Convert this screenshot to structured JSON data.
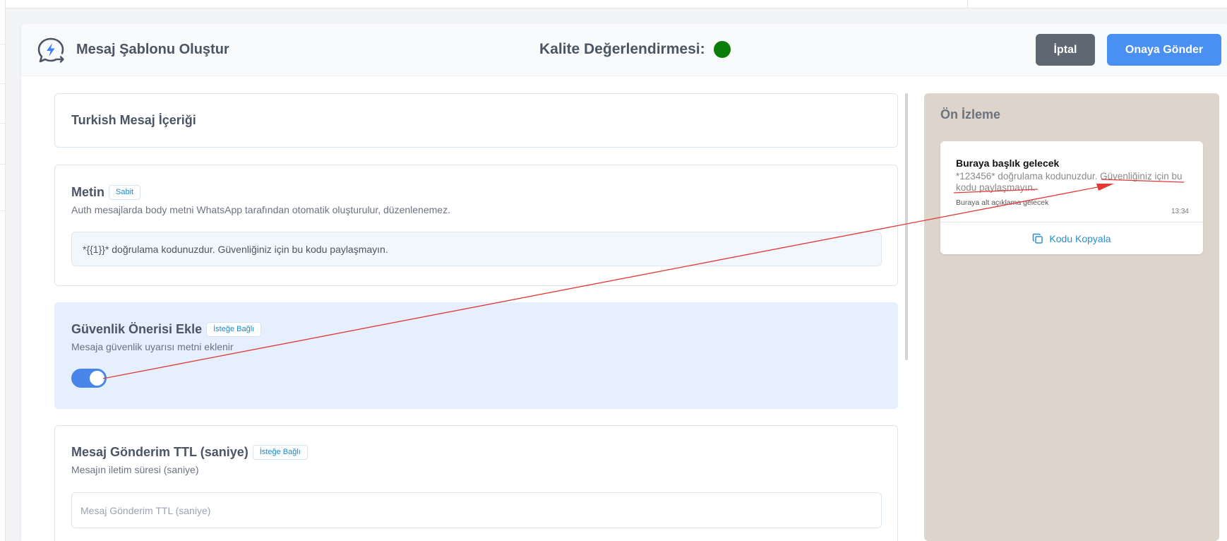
{
  "header": {
    "title": "Mesaj Şablonu Oluştur",
    "quality_label": "Kalite Değerlendirmesi:",
    "quality_color": "#0a7d0a",
    "cancel_label": "İptal",
    "submit_label": "Onaya Gönder"
  },
  "content_card": {
    "title": "Turkish Mesaj İçeriği"
  },
  "body_field": {
    "title": "Metin",
    "badge": "Sabit",
    "description": "Auth mesajlarda body metni WhatsApp tarafından otomatik oluşturulur, düzenlenemez.",
    "value": "*{{1}}* doğrulama kodunuzdur. Güvenliğiniz için bu kodu paylaşmayın."
  },
  "security_field": {
    "title": "Güvenlik Önerisi Ekle",
    "badge": "İsteğe Bağlı",
    "description": "Mesaja güvenlik uyarısı metni eklenir",
    "enabled": true
  },
  "ttl_field": {
    "title": "Mesaj Gönderim TTL (saniye)",
    "badge": "İsteğe Bağlı",
    "description": "Mesajın iletim süresi (saniye)",
    "placeholder": "Mesaj Gönderim TTL (saniye)"
  },
  "preview": {
    "title": "Ön İzleme",
    "bubble_title": "Buraya başlık gelecek",
    "bubble_body": "*123456* doğrulama kodunuzdur. Güvenliğiniz için bu kodu paylaşmayın.",
    "bubble_footer": "Buraya alt açıklama gelecek",
    "time": "13:34",
    "copy_label": "Kodu Kopyala"
  },
  "colors": {
    "primary": "#4a90f2",
    "annotation": "#e53935"
  }
}
